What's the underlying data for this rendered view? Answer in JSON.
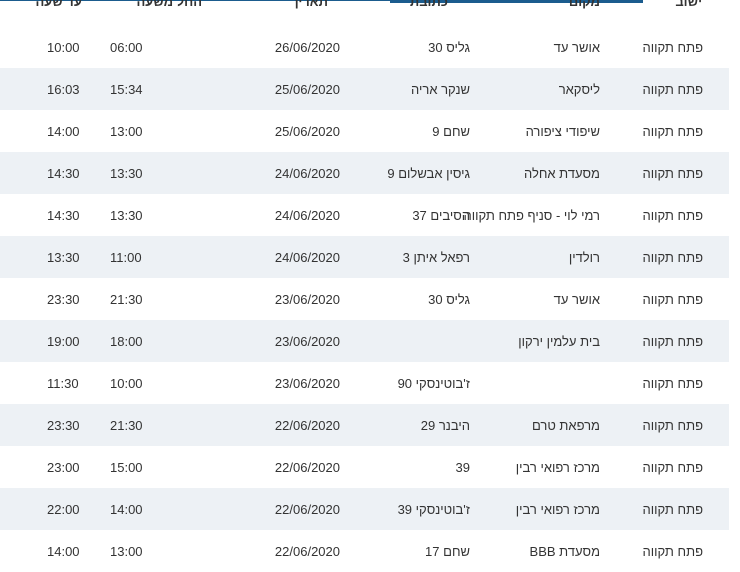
{
  "headers": {
    "city": "ישוב",
    "place": "מקום",
    "address": "כתובת",
    "date": "תאריך",
    "from": "החל משעה",
    "to": "עד שעה"
  },
  "rows": [
    {
      "city": "פתח תקווה",
      "place": "אושר עד",
      "address": "גליס 30",
      "date": "26/06/2020",
      "from": "06:00",
      "to": "10:00"
    },
    {
      "city": "פתח תקווה",
      "place": "ליסקאר",
      "address": "שנקר אריה",
      "date": "25/06/2020",
      "from": "15:34",
      "to": "16:03"
    },
    {
      "city": "פתח תקווה",
      "place": "שיפודי ציפורה",
      "address": "שחם 9",
      "date": "25/06/2020",
      "from": "13:00",
      "to": "14:00"
    },
    {
      "city": "פתח תקווה",
      "place": "מסעדת אחלה",
      "address": "גיסין אבשלום 9",
      "date": "24/06/2020",
      "from": "13:30",
      "to": "14:30"
    },
    {
      "city": "פתח תקווה",
      "place": "רמי לוי - סניף פתח תקווה",
      "address": "הסיבים 37",
      "date": "24/06/2020",
      "from": "13:30",
      "to": "14:30"
    },
    {
      "city": "פתח תקווה",
      "place": "רולדין",
      "address": "רפאל איתן 3",
      "date": "24/06/2020",
      "from": "11:00",
      "to": "13:30"
    },
    {
      "city": "פתח תקווה",
      "place": "אושר עד",
      "address": "גליס 30",
      "date": "23/06/2020",
      "from": "21:30",
      "to": "23:30"
    },
    {
      "city": "פתח תקווה",
      "place": "בית עלמין ירקון",
      "address": "",
      "date": "23/06/2020",
      "from": "18:00",
      "to": "19:00"
    },
    {
      "city": "פתח תקווה",
      "place": "",
      "address": "ז'בוטינסקי 90",
      "date": "23/06/2020",
      "from": "10:00",
      "to": "11:30"
    },
    {
      "city": "פתח תקווה",
      "place": "מרפאת טרם",
      "address": "היבנר 29",
      "date": "22/06/2020",
      "from": "21:30",
      "to": "23:30"
    },
    {
      "city": "פתח תקווה",
      "place": "מרכז רפואי רבין",
      "address": "39",
      "date": "22/06/2020",
      "from": "15:00",
      "to": "23:00"
    },
    {
      "city": "פתח תקווה",
      "place": "מרכז רפואי רבין",
      "address": "ז'בוטינסקי 39",
      "date": "22/06/2020",
      "from": "14:00",
      "to": "22:00"
    },
    {
      "city": "פתח תקווה",
      "place": "מסעדת BBB",
      "address": "שחם 17",
      "date": "22/06/2020",
      "from": "13:00",
      "to": "14:00"
    }
  ],
  "colors": {
    "accent": "#1b5c8e",
    "row_alt": "#edf1f5",
    "text": "#333333"
  }
}
